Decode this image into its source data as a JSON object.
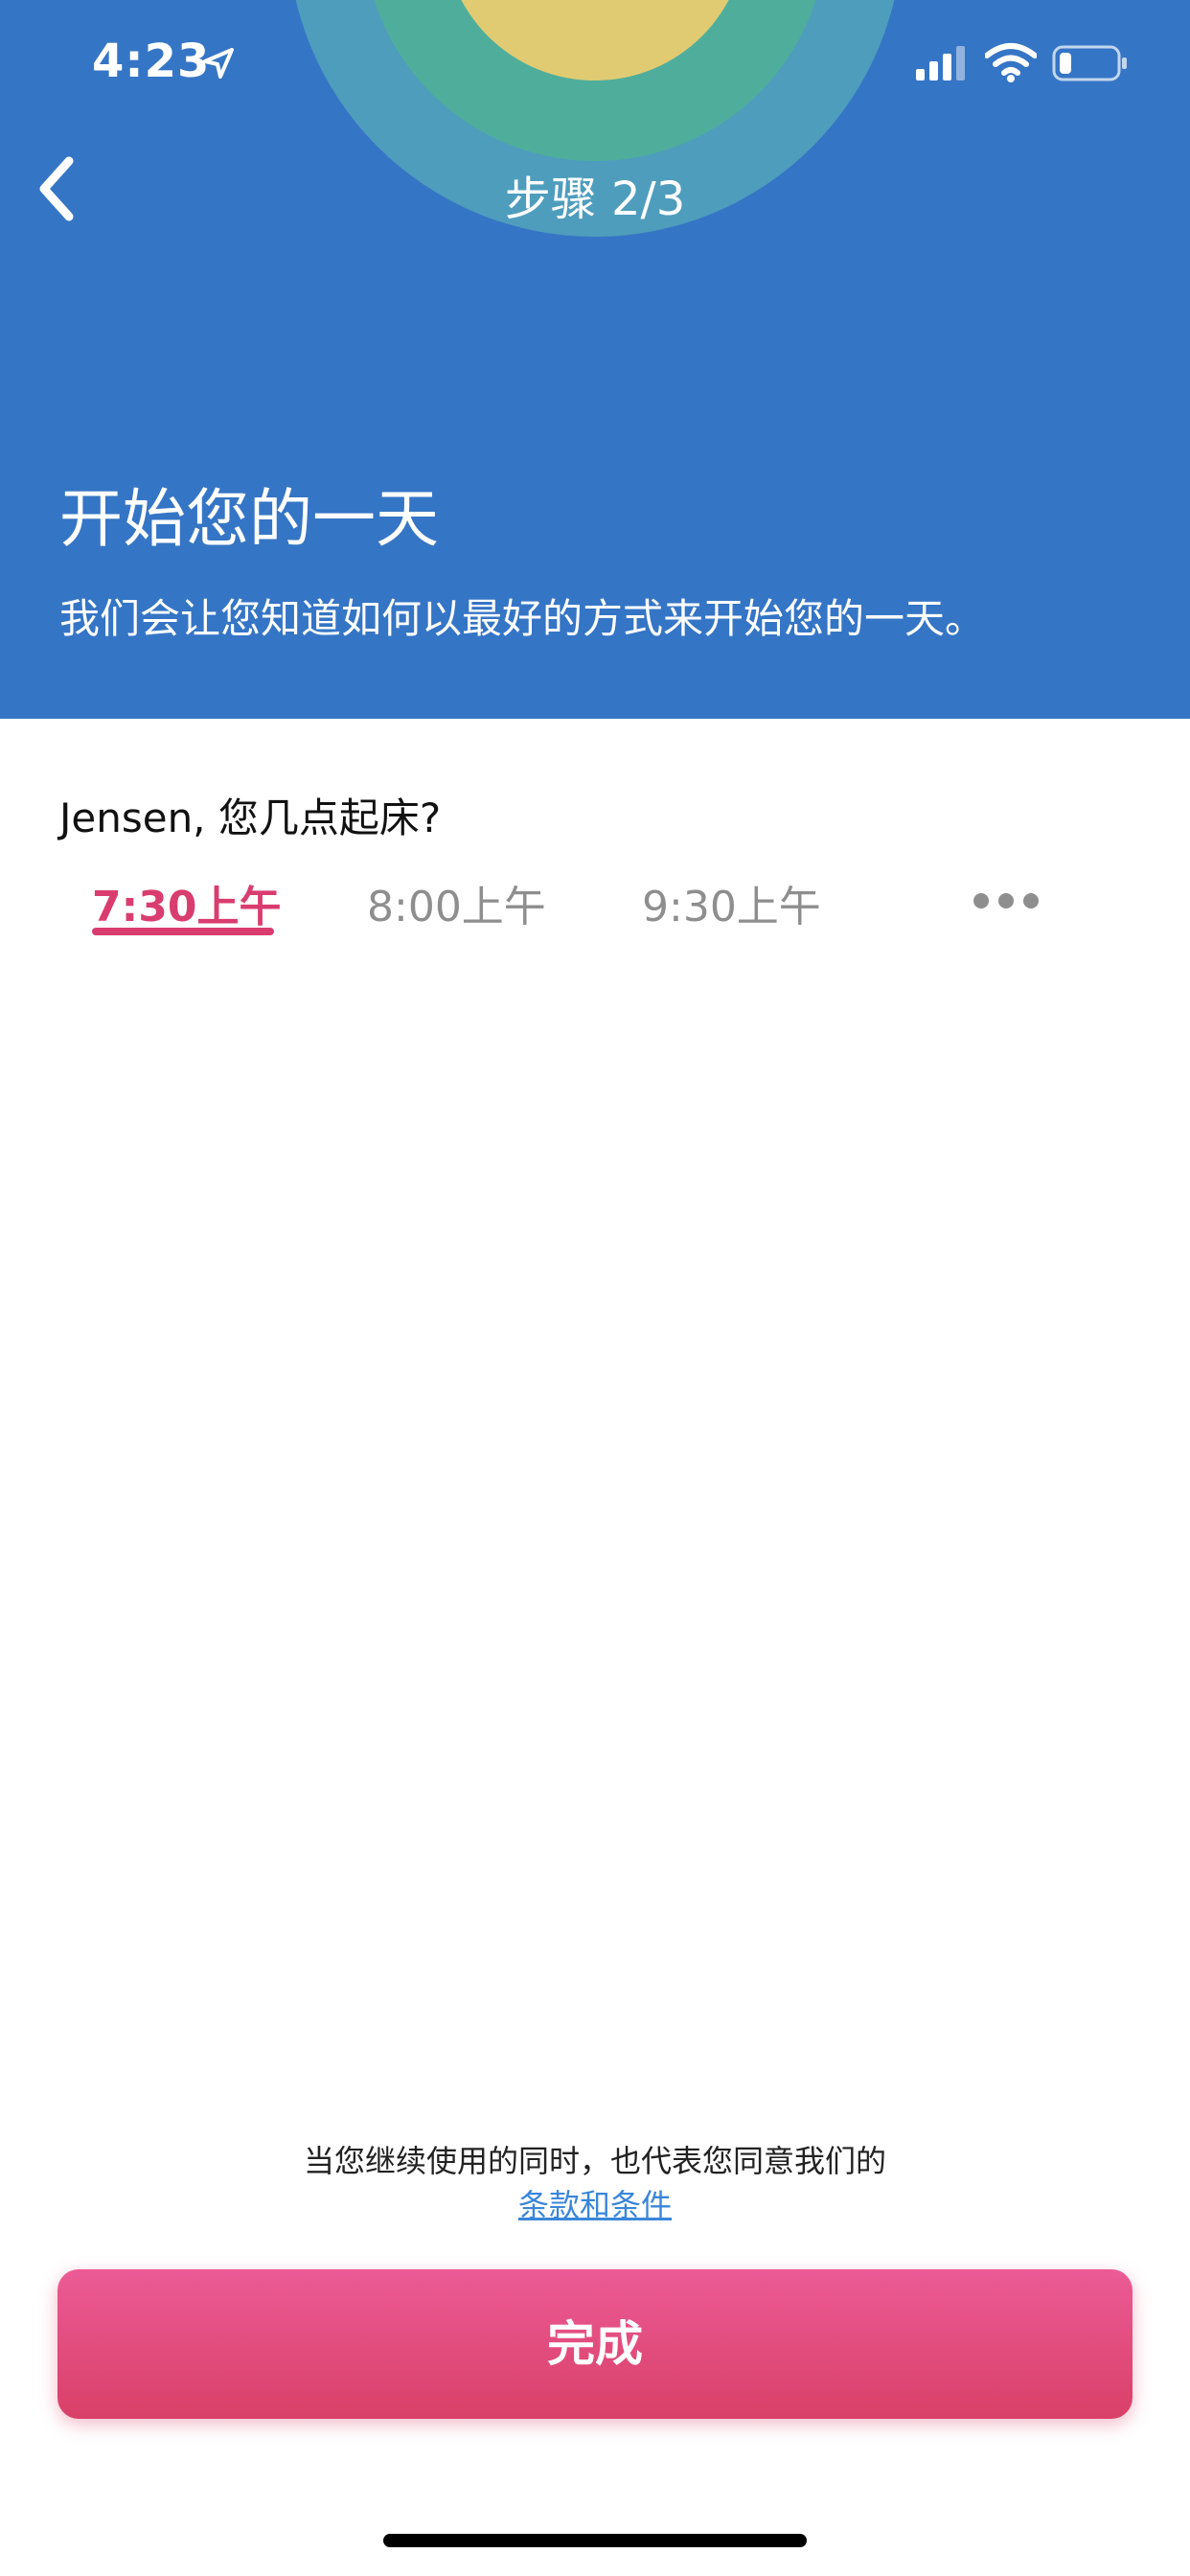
{
  "status_bar": {
    "time": "4:23"
  },
  "nav": {
    "title": "步骤 2/3"
  },
  "header": {
    "title": "开始您的一天",
    "subtitle": "我们会让您知道如何以最好的方式来开始您的一天。"
  },
  "question": "Jensen, 您几点起床?",
  "time_options": [
    {
      "label": "7:30上午",
      "selected": true
    },
    {
      "label": "8:00上午",
      "selected": false
    },
    {
      "label": "9:30上午",
      "selected": false
    }
  ],
  "footer": {
    "terms_text": "当您继续使用的同时，也代表您同意我们的",
    "terms_link": "条款和条件",
    "done_label": "完成"
  },
  "colors": {
    "header_bg": "#3575c5",
    "accent": "#d93d6f",
    "button_top": "#ec5b96",
    "button_bottom": "#d94068",
    "link": "#3a86d9"
  },
  "icons": [
    "location-arrow-icon",
    "signal-icon",
    "wifi-icon",
    "battery-icon",
    "back-chevron-icon",
    "sun-graphic",
    "more-dots-icon"
  ]
}
